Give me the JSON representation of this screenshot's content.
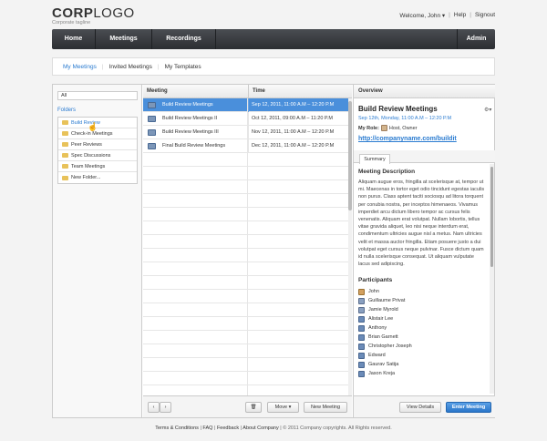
{
  "header": {
    "logo_bold": "CORP",
    "logo_light": "LOGO",
    "tagline": "Corporate tagline",
    "welcome": "Welcome, John ▾",
    "help": "Help",
    "signout": "Signout"
  },
  "nav": {
    "items": [
      "Home",
      "Meetings",
      "Recordings"
    ],
    "admin": "Admin"
  },
  "subnav": {
    "tabs": [
      "My Meetings",
      "Invited Meetings",
      "My Templates"
    ]
  },
  "folders": {
    "all_value": "All",
    "label": "Folders",
    "items": [
      "Build Review",
      "Check-in Meetings",
      "Peer Reviews",
      "Spec Discussions",
      "Team Meetings",
      "New Folder..."
    ]
  },
  "meetings": {
    "col_meeting": "Meeting",
    "col_time": "Time",
    "rows": [
      {
        "title": "Build Review Meetings",
        "time": "Sep 12, 2011, 11:00 A.M – 12:20 P.M"
      },
      {
        "title": "Build Review Meetings II",
        "time": "Oct 12, 2011, 09:00 A.M – 11:20 P.M"
      },
      {
        "title": "Build Review Meetings III",
        "time": "Nov 12, 2011, 11:00 A.M – 12:20 P.M"
      },
      {
        "title": "Final Build Review Meetings",
        "time": "Dec 12, 2011, 11:00 A.M – 12:20 P.M"
      }
    ],
    "prev": "‹",
    "next": "›",
    "move_label": "Move ▾",
    "new_meeting_label": "New Meeting"
  },
  "overview": {
    "header": "Overview",
    "title": "Build Review Meetings",
    "date": "Sep 12th, Monday, 11:00 A.M – 12:20 P.M",
    "role_label": "My Role:",
    "role_value": "Host, Owner",
    "url": "http://companyname.com/buildit",
    "tab": "Summary",
    "desc_heading": "Meeting Description",
    "description": "Aliquam augue eros, fringilla at scelerisque at, tempor ut mi. Maecenas in tortor eget odio tincidunt egestas iaculis non purus. Class aptent taciti sociosqu ad litora torquent per conubia nostra, per inceptos himenaeos. Vivamus imperdiet arcu dictum libero tempor ac cursus felis venenatis. Aliquam erat volutpat. Nullam lobortis, tellus vitae gravida aliquet, leo nisi neque interdum erat, condimentum ultricies augue nisl a metus. Nam ultricies velit et massa auctor fringilla. Etiam posuere justo a dui volutpat eget cursus neque pulvinar. Fusce dictum quam id nulla scelerisque consequat. Ut aliquam vulputate lacus sed adipiscing.",
    "participants_heading": "Participants",
    "participants": [
      "John",
      "Guillaume Privat",
      "Jamie Myrold",
      "Alistair Lee",
      "Anthony",
      "Brian Garnett",
      "Christopher Joseph",
      "Edward",
      "Gaurav Satija",
      "Jason Kreja"
    ],
    "view_details": "View Details",
    "enter_meeting": "Enter Meeting"
  },
  "footer": {
    "links": [
      "Terms & Conditions",
      "FAQ",
      "Feedback",
      "About Company"
    ],
    "copyright": "© 2011 Company copyrights. All Rights reserved."
  }
}
